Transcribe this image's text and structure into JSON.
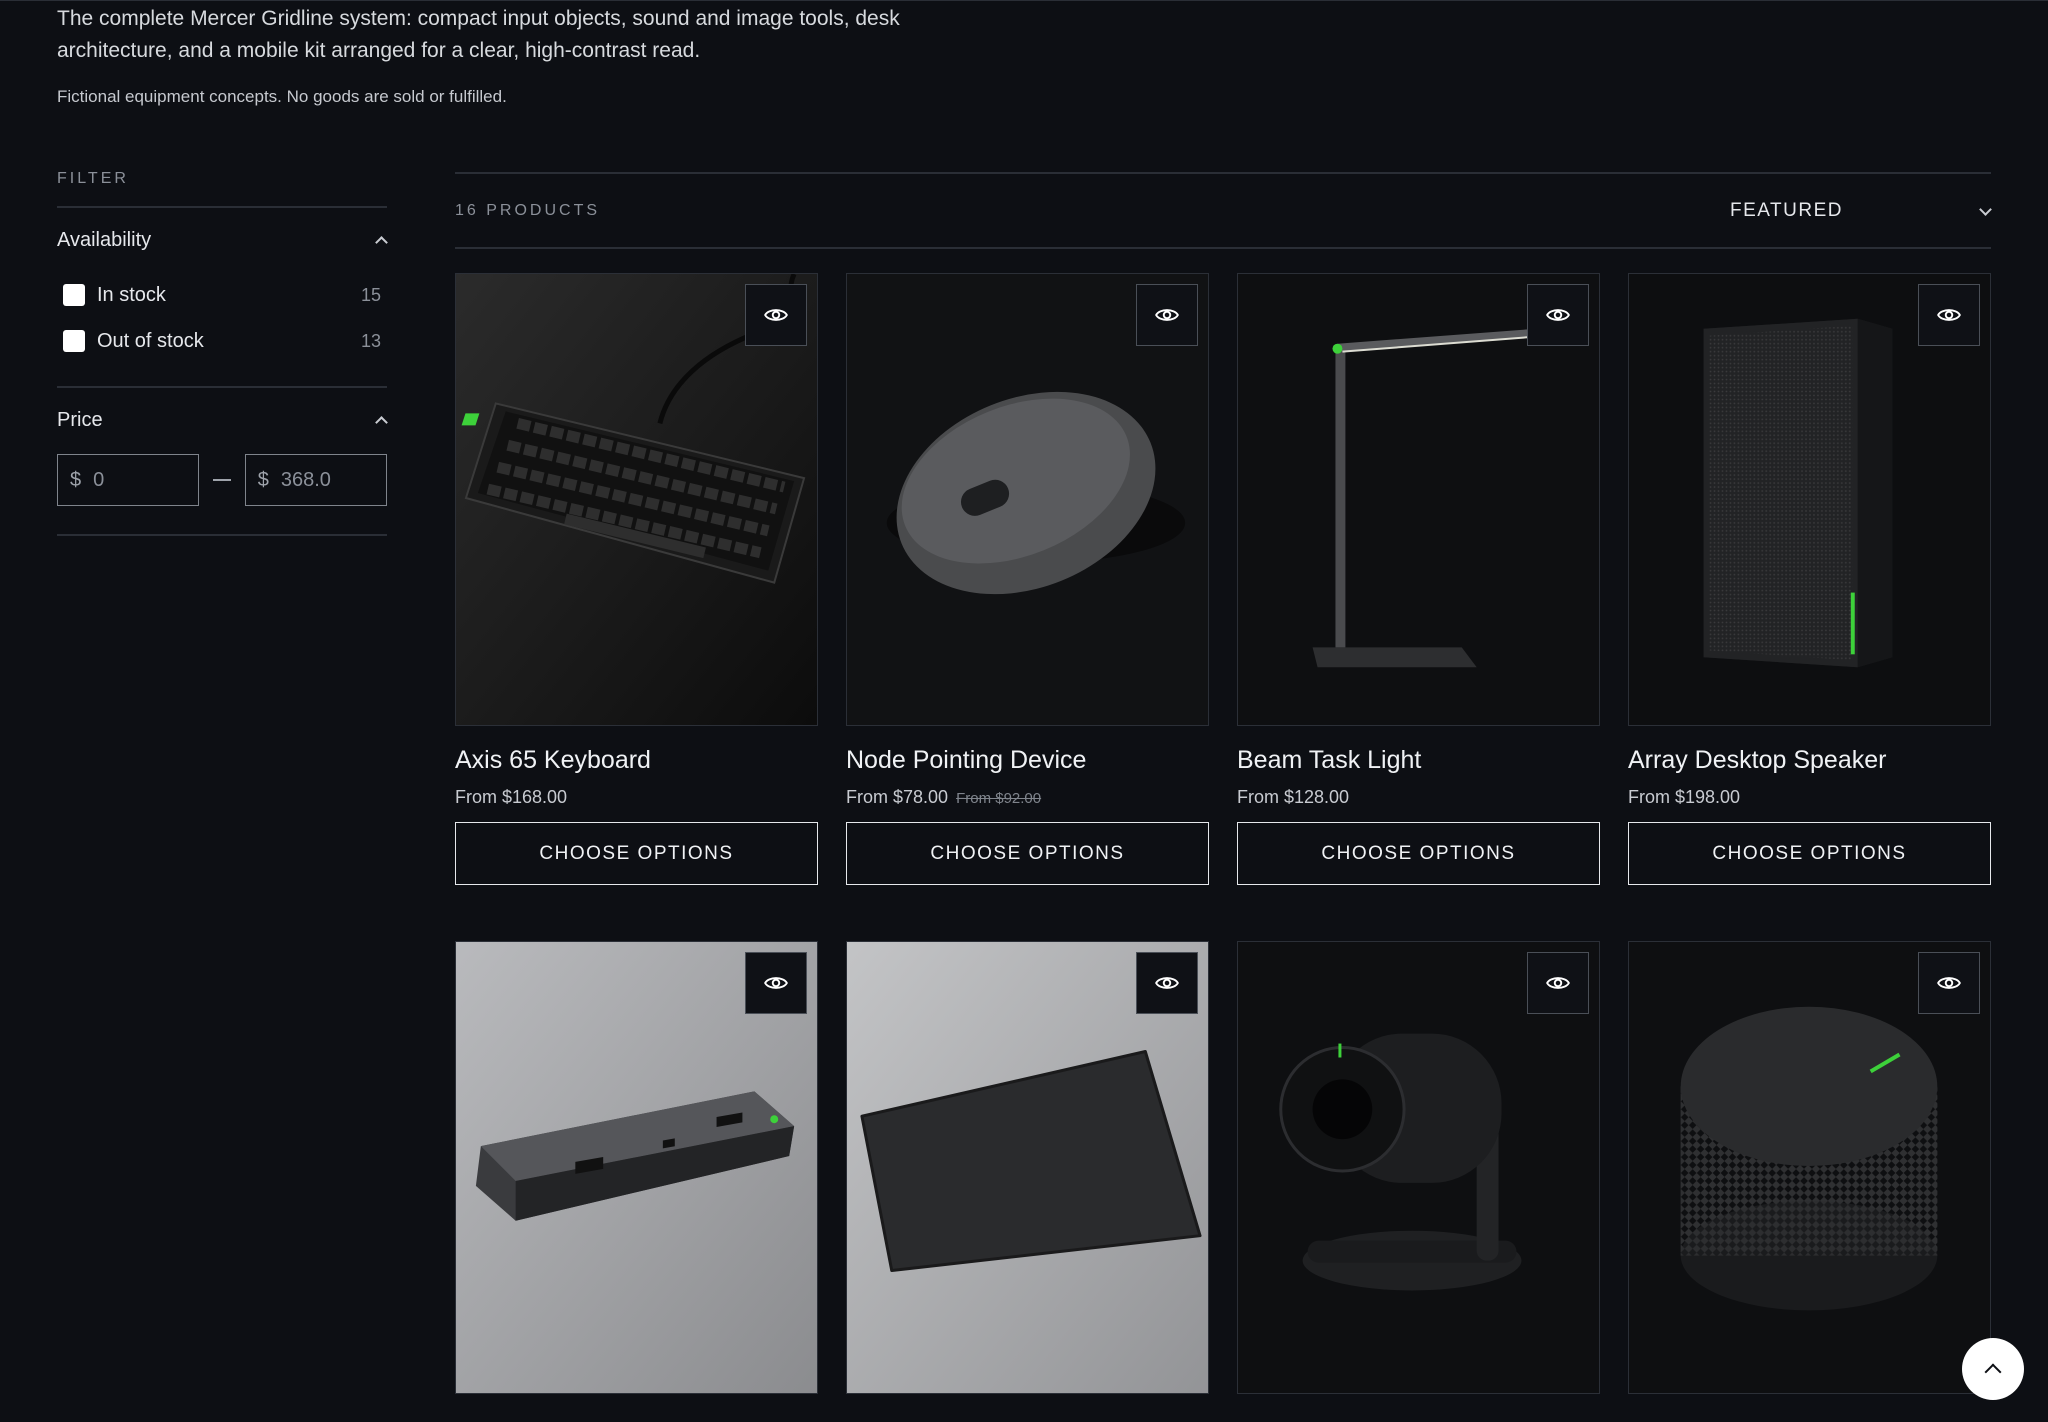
{
  "intro": {
    "description": "The complete Mercer Gridline system: compact input objects, sound and image tools, desk architecture, and a mobile kit arranged for a clear, high-contrast read.",
    "note": "Fictional equipment concepts. No goods are sold or fulfilled."
  },
  "filter": {
    "title": "FILTER",
    "availability": {
      "title": "Availability",
      "options": [
        {
          "label": "In stock",
          "count": "15"
        },
        {
          "label": "Out of stock",
          "count": "13"
        }
      ]
    },
    "price": {
      "title": "Price",
      "currency": "$",
      "min_placeholder": "0",
      "max_placeholder": "368.0"
    }
  },
  "toolbar": {
    "count": "16 PRODUCTS",
    "sort": "FEATURED"
  },
  "products": [
    {
      "name": "Axis 65 Keyboard",
      "price": "From $168.00",
      "compare": "",
      "button": "CHOOSE OPTIONS"
    },
    {
      "name": "Node Pointing Device",
      "price": "From $78.00",
      "compare": "From $92.00",
      "button": "CHOOSE OPTIONS"
    },
    {
      "name": "Beam Task Light",
      "price": "From $128.00",
      "compare": "",
      "button": "CHOOSE OPTIONS"
    },
    {
      "name": "Array Desktop Speaker",
      "price": "From $198.00",
      "compare": "",
      "button": "CHOOSE OPTIONS"
    },
    {
      "name": "",
      "price": "",
      "compare": "",
      "button": ""
    },
    {
      "name": "",
      "price": "",
      "compare": "",
      "button": ""
    },
    {
      "name": "",
      "price": "",
      "compare": "",
      "button": ""
    },
    {
      "name": "",
      "price": "",
      "compare": "",
      "button": ""
    }
  ],
  "colors": {
    "background": "#0d0f14",
    "accent_led": "#3dd13a",
    "text": "#e6e8ec",
    "muted": "#8b9099"
  },
  "icons": {
    "quick_view": "eye-icon",
    "sort": "chevron-down-icon",
    "collapse": "chevron-up-icon",
    "scroll_top": "chevron-up-icon"
  }
}
